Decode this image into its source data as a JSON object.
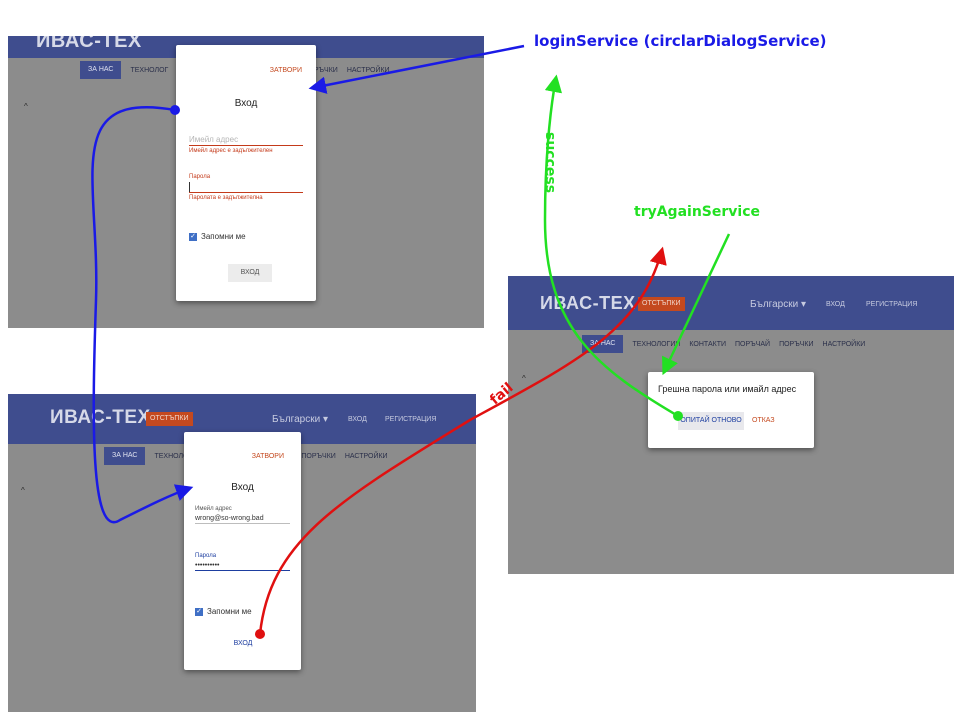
{
  "screens": {
    "login_empty": {
      "logo": "ИВАС-ТЕХ",
      "nav": [
        "ЗА НАС",
        "ТЕХНОЛОГ",
        "ПОРЪЧКИ",
        "НАСТРОЙКИ"
      ],
      "caret": "^",
      "dialog": {
        "close": "ЗАТВОРИ",
        "title": "Вход",
        "email_placeholder": "Имейл адрес",
        "email_error": "Имейл адрес е задължителен",
        "password_label": "Парола",
        "password_error": "Паролата е задължителна",
        "remember": "Запомни ме",
        "submit": "ВХОД"
      }
    },
    "login_filled": {
      "logo": "ИВАС-ТЕХ",
      "promo": "ОТСТЪПКИ",
      "language": "Български ▾",
      "login_link": "ВХОД",
      "register_link": "РЕГИСТРАЦИЯ",
      "nav": [
        "ЗА НАС",
        "ТЕХНОЛОГ",
        "ПОРЪЧКИ",
        "НАСТРОЙКИ"
      ],
      "caret": "^",
      "dialog": {
        "close": "ЗАТВОРИ",
        "title": "Вход",
        "email_label": "Имейл адрес",
        "email_value": "wrong@so-wrong.bad",
        "password_label": "Парола",
        "password_value": "••••••••••",
        "remember": "Запомни ме",
        "submit": "ВХОД"
      }
    },
    "error": {
      "logo": "ИВАС-ТЕХ",
      "promo": "ОТСТЪПКИ",
      "language": "Български ▾",
      "login_link": "ВХОД",
      "register_link": "РЕГИСТРАЦИЯ",
      "nav": [
        "ЗА НАС",
        "ТЕХНОЛОГИИ",
        "КОНТАКТИ",
        "ПОРЪЧАЙ",
        "ПОРЪЧКИ",
        "НАСТРОЙКИ"
      ],
      "caret": "^",
      "dialog": {
        "message": "Грешна парола или имайл адрес",
        "retry": "ОПИТАЙ ОТНОВО",
        "cancel": "ОТКАЗ"
      }
    }
  },
  "annotations": {
    "login_service": "loginService (circlarDialogService)",
    "success": "success",
    "try_again_service": "tryAgainService",
    "fail": "fail"
  },
  "colors": {
    "header": "#3f4d8e",
    "overlay": "#8c8c8c",
    "accent_orange": "#c4491f",
    "arrow_blue": "#1a1ae6",
    "arrow_green": "#22e022",
    "arrow_red": "#e01010"
  }
}
